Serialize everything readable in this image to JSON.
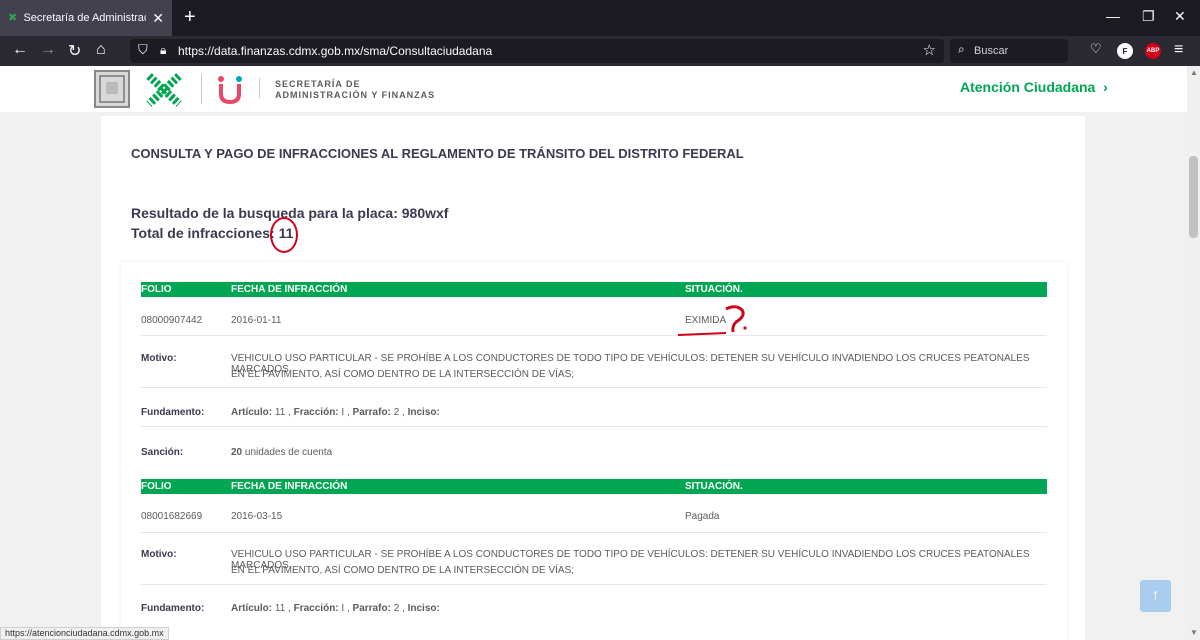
{
  "browser": {
    "tab_title": "Secretaría de Administración y Finanzas",
    "url": "https://data.finanzas.cdmx.gob.mx/sma/Consultaciudadana",
    "search_placeholder": "Buscar",
    "ext_f": "F",
    "ext_abp": "ABP"
  },
  "header": {
    "secretaria_line1": "SECRETARÍA DE",
    "secretaria_line2": "ADMINISTRACIÓN Y FINANZAS",
    "atencion": "Atención Ciudadana"
  },
  "main": {
    "title": "CONSULTA Y PAGO DE INFRACCIONES AL REGLAMENTO DE TRÁNSITO DEL DISTRITO FEDERAL",
    "result_label": "Resultado de la busqueda para la placa:",
    "placa": "980wxf",
    "total_label": "Total de infracciones:",
    "total": "11"
  },
  "table_headers": {
    "folio": "FOLIO",
    "fecha": "FECHA DE INFRACCIÓN",
    "situacion": "SITUACIÓN."
  },
  "labels": {
    "motivo": "Motivo:",
    "fundamento": "Fundamento:",
    "sancion": "Sanción:",
    "articulo": "Artículo:",
    "fraccion": "Fracción:",
    "parrafo": "Parrafo:",
    "inciso": "Inciso:"
  },
  "infracciones": [
    {
      "folio": "08000907442",
      "fecha": "2016-01-11",
      "situacion": "EXIMIDA",
      "motivo_1": "VEHICULO USO PARTICULAR - SE PROHÍBE A LOS CONDUCTORES DE TODO TIPO DE VEHÍCULOS: DETENER SU VEHÍCULO INVADIENDO LOS CRUCES PEATONALES MARCADOS",
      "motivo_2": "EN EL PAVIMENTO, ASÍ COMO DENTRO DE LA INTERSECCIÓN DE VÍAS;",
      "articulo": "11",
      "fraccion": "I",
      "parrafo": "2",
      "sancion_valor": "20",
      "sancion_unidad": "unidades de cuenta"
    },
    {
      "folio": "08001682669",
      "fecha": "2016-03-15",
      "situacion": "Pagada",
      "motivo_1": "VEHICULO USO PARTICULAR - SE PROHÍBE A LOS CONDUCTORES DE TODO TIPO DE VEHÍCULOS: DETENER SU VEHÍCULO INVADIENDO LOS CRUCES PEATONALES MARCADOS",
      "motivo_2": "EN EL PAVIMENTO, ASÍ COMO DENTRO DE LA INTERSECCIÓN DE VÍAS;",
      "articulo": "11",
      "fraccion": "I",
      "parrafo": "2"
    }
  ],
  "statusbar": "https://atencionciudadana.cdmx.gob.mx",
  "colors": {
    "green": "#00a651",
    "annotation_red": "#d0021b"
  }
}
